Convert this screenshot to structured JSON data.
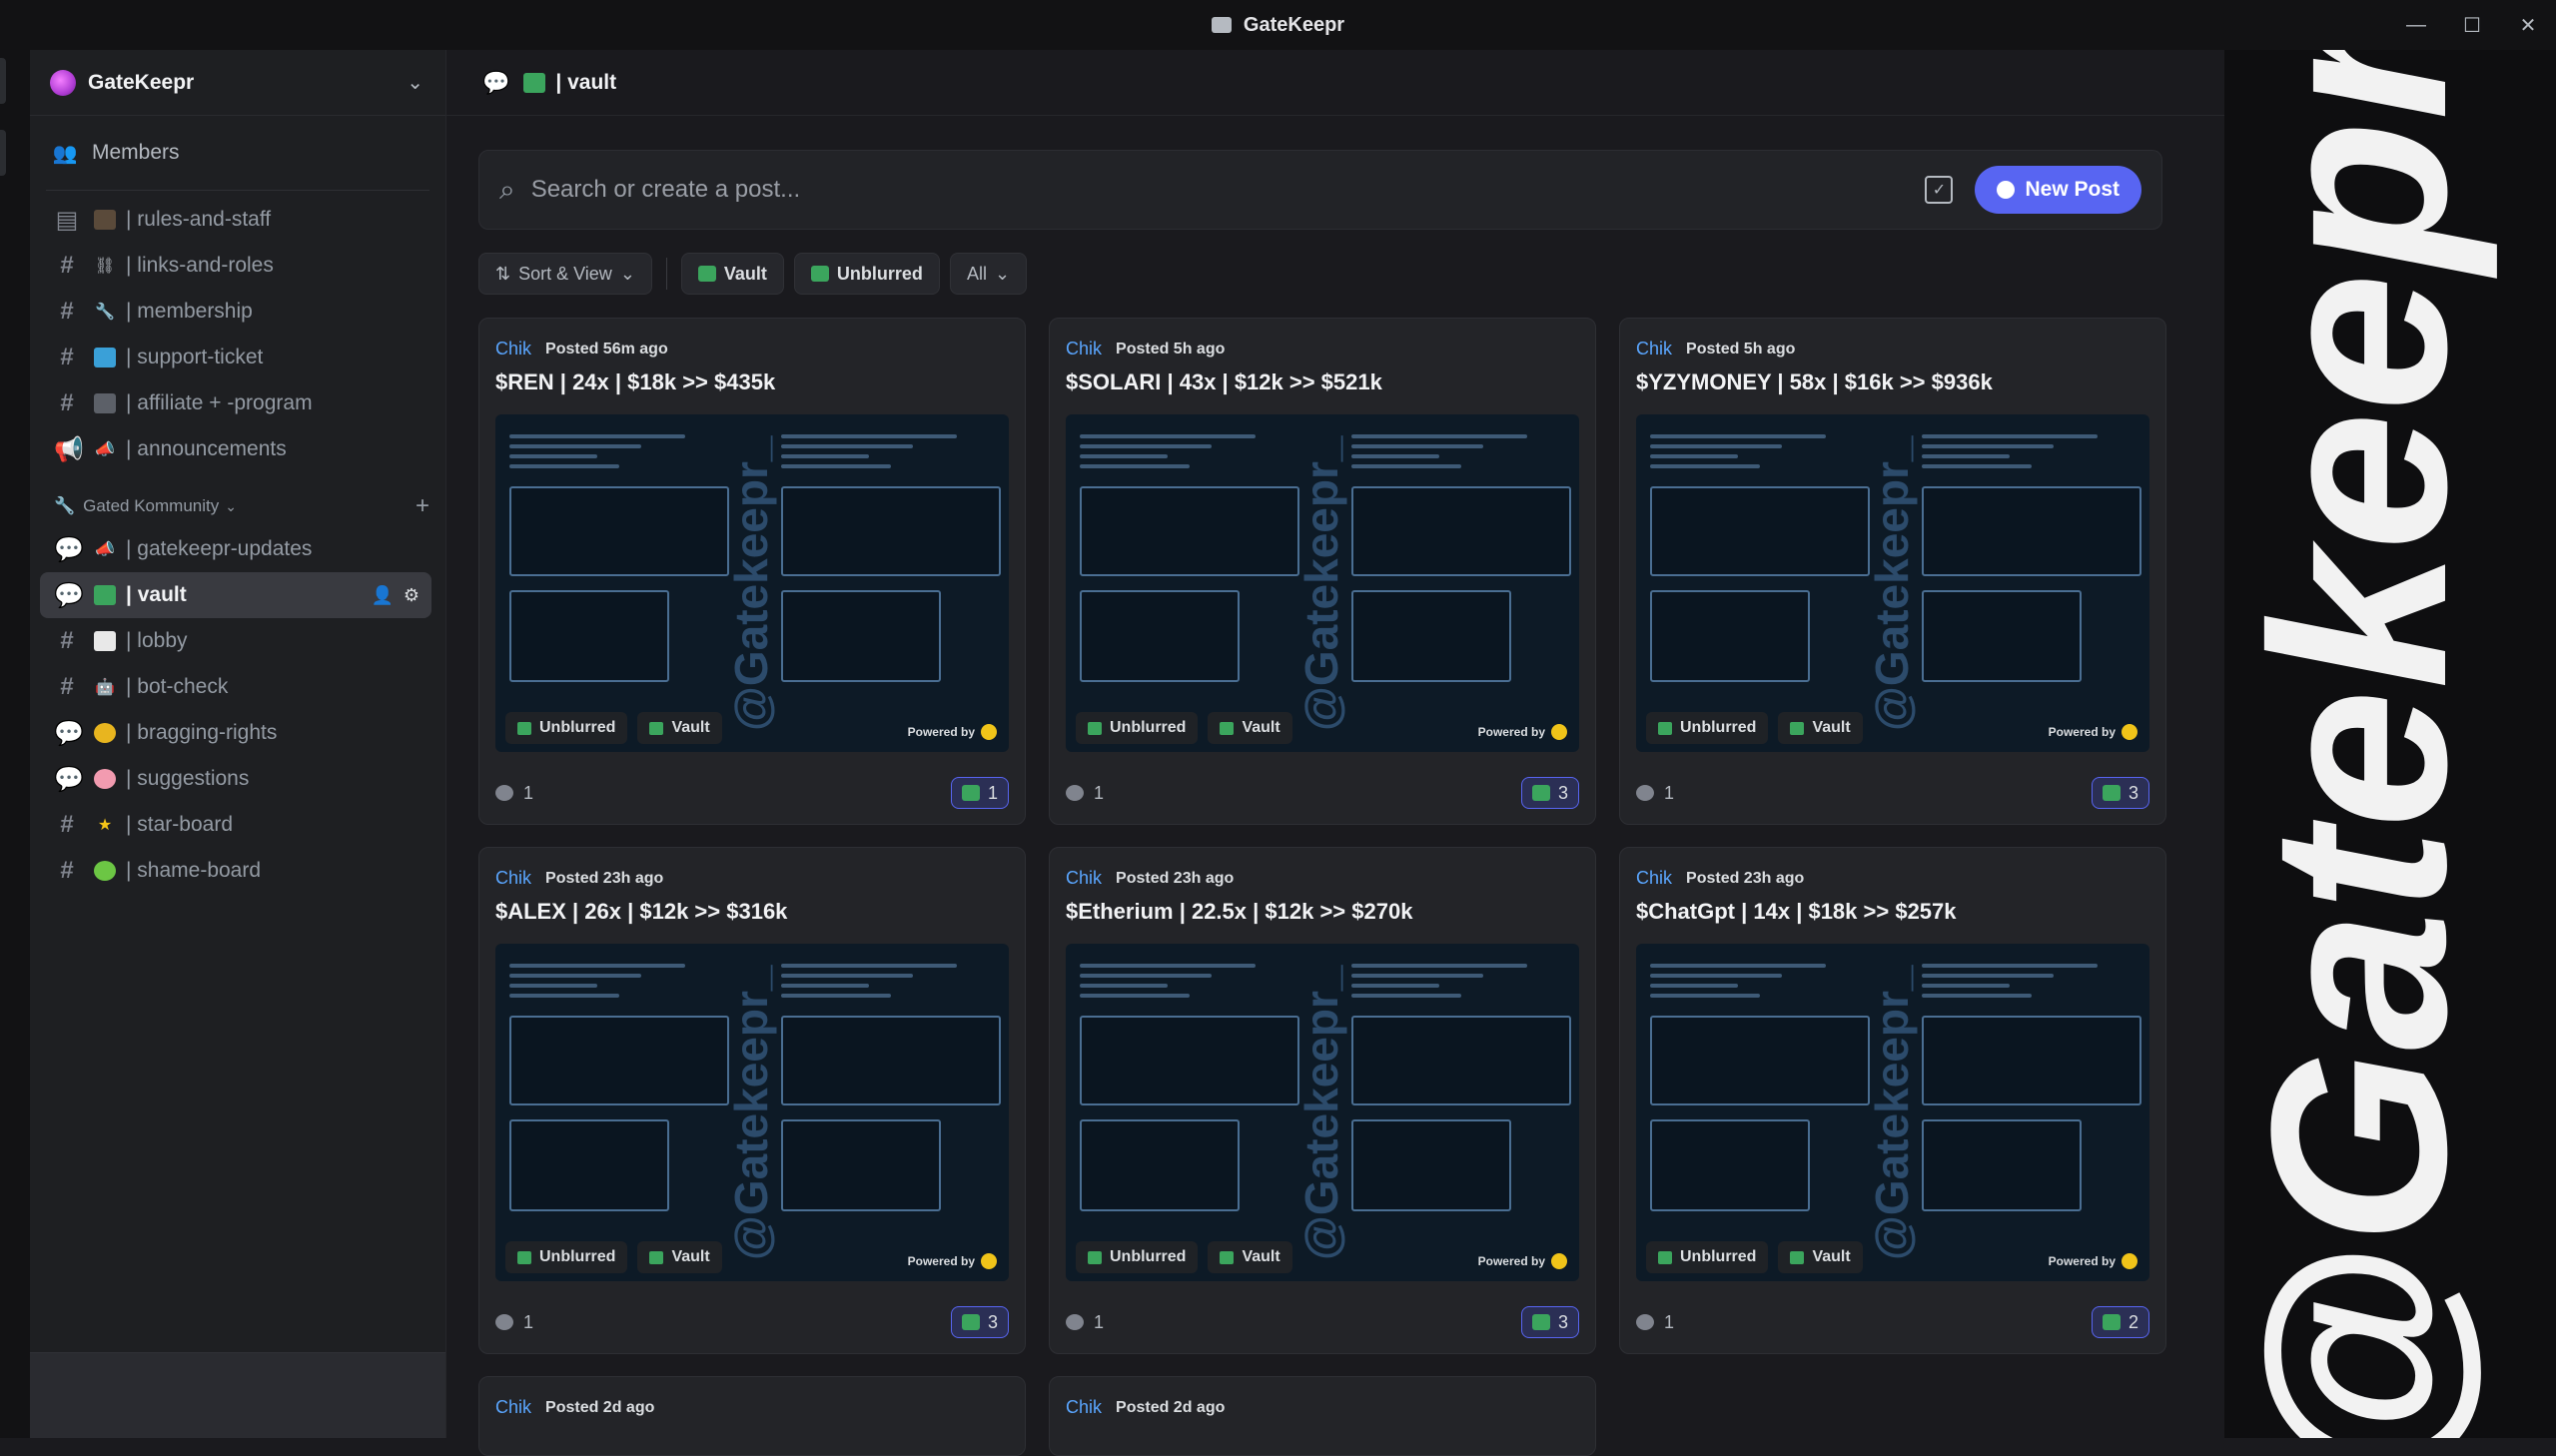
{
  "window": {
    "title": "GateKeepr",
    "controls": [
      "—",
      "☐",
      "✕"
    ]
  },
  "server": {
    "name": "GateKeepr"
  },
  "sidebar": {
    "members_label": "Members",
    "channels": [
      {
        "label": "| rules-and-staff",
        "icon": "briefcase-icon",
        "type": "text"
      },
      {
        "label": "| links-and-roles",
        "icon": "link-icon",
        "type": "hash"
      },
      {
        "label": "| membership",
        "icon": "wrench-icon",
        "type": "hash"
      },
      {
        "label": "| support-ticket",
        "icon": "ticket-icon",
        "type": "hash"
      },
      {
        "label": "| affiliate + -program",
        "icon": "people-icon",
        "type": "hash"
      },
      {
        "label": "| announcements",
        "icon": "megaphone-icon",
        "type": "announce"
      }
    ],
    "category": {
      "label": "Gated Kommunity"
    },
    "gated_channels": [
      {
        "label": "| gatekeepr-updates",
        "icon": "megaphone-icon",
        "type": "forum"
      },
      {
        "label": "| vault",
        "icon": "vault-icon",
        "type": "forum",
        "active": true
      },
      {
        "label": "| lobby",
        "icon": "speech-bubble-icon",
        "type": "hash"
      },
      {
        "label": "| bot-check",
        "icon": "robot-icon",
        "type": "hash"
      },
      {
        "label": "| bragging-rights",
        "icon": "medal-icon",
        "type": "forum"
      },
      {
        "label": "| suggestions",
        "icon": "brain-icon",
        "type": "forum"
      },
      {
        "label": "| star-board",
        "icon": "star-icon",
        "type": "hash"
      },
      {
        "label": "| shame-board",
        "icon": "alien-icon",
        "type": "hash"
      }
    ]
  },
  "channel_header": {
    "title": "| vault"
  },
  "search": {
    "placeholder": "Search or create a post...",
    "new_post_label": "New Post"
  },
  "filters": {
    "sort_label": "Sort & View",
    "tags": [
      "Vault",
      "Unblurred"
    ],
    "all_label": "All"
  },
  "posts": [
    {
      "author": "Chik",
      "posted": "Posted 56m ago",
      "title": "$REN  |  24x  |  $18k >> $435k",
      "replies": "1",
      "reactions": "1"
    },
    {
      "author": "Chik",
      "posted": "Posted 5h ago",
      "title": "$SOLARI  |  43x  |  $12k >> $521k",
      "replies": "1",
      "reactions": "3"
    },
    {
      "author": "Chik",
      "posted": "Posted 5h ago",
      "title": "$YZYMONEY  |  58x  |  $16k >> $936k",
      "replies": "1",
      "reactions": "3"
    },
    {
      "author": "Chik",
      "posted": "Posted 23h ago",
      "title": "$ALEX  |  26x  |  $12k >> $316k",
      "replies": "1",
      "reactions": "3"
    },
    {
      "author": "Chik",
      "posted": "Posted 23h ago",
      "title": "$Etherium |  22.5x  | $12k >> $270k",
      "replies": "1",
      "reactions": "3"
    },
    {
      "author": "Chik",
      "posted": "Posted 23h ago",
      "title": "$ChatGpt  |  14x  |  $18k >> $257k",
      "replies": "1",
      "reactions": "2"
    },
    {
      "author": "Chik",
      "posted": "Posted 2d ago",
      "title": ""
    },
    {
      "author": "Chik",
      "posted": "Posted 2d ago",
      "title": ""
    }
  ],
  "post_tags": {
    "unblurred": "Unblurred",
    "vault": "Vault",
    "powered_by": "Powered by",
    "watermark": "@Gatekeepr_"
  },
  "overlay_watermark": "@Gatekeepr",
  "colors": {
    "accent": "#5865f2",
    "link": "#5aa6ff",
    "tag_green": "#3ba55d"
  }
}
